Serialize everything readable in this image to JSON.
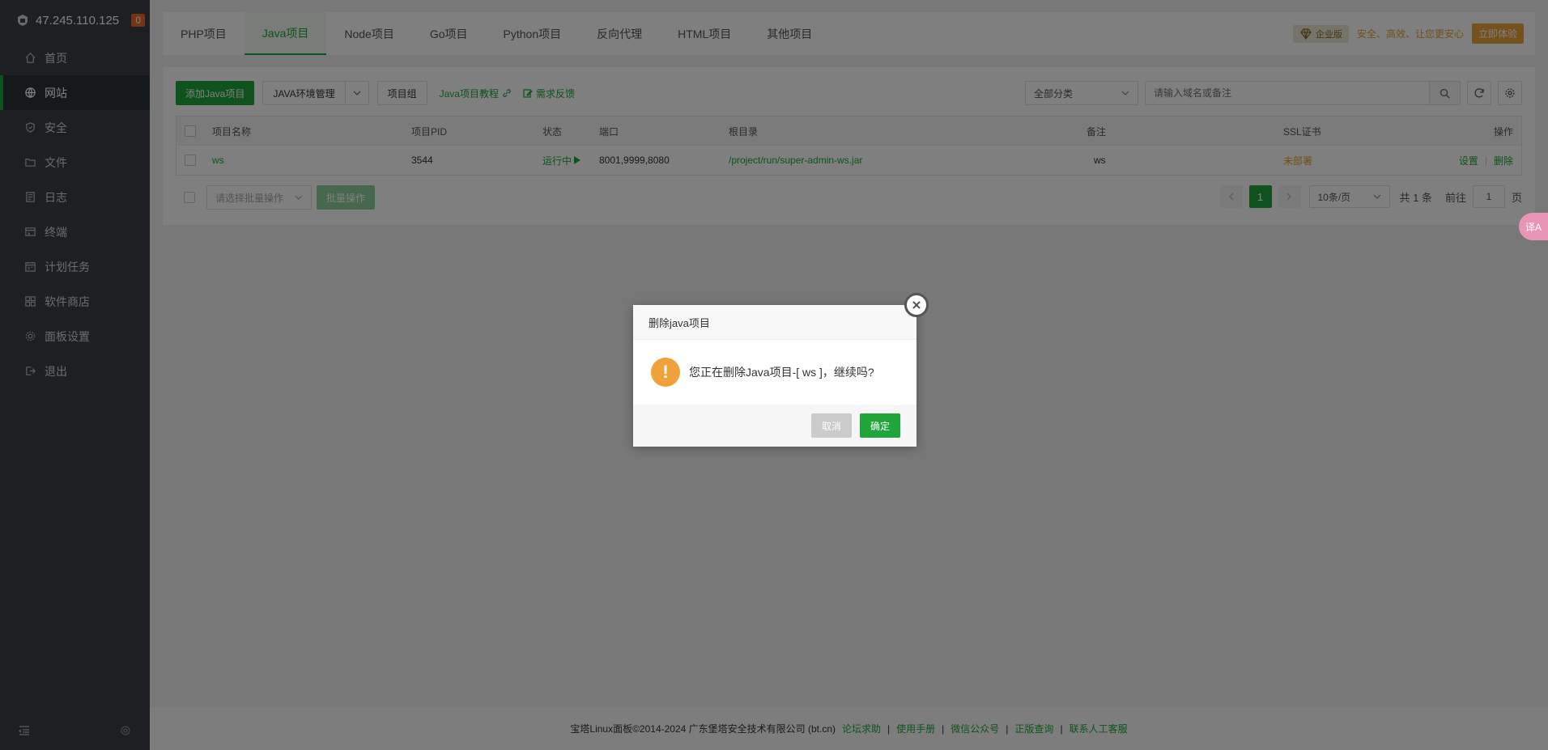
{
  "sidebar": {
    "server_ip": "47.245.110.125",
    "badge_count": "0",
    "items": [
      {
        "label": "首页",
        "icon": "home-icon"
      },
      {
        "label": "网站",
        "icon": "globe-icon",
        "active": true
      },
      {
        "label": "安全",
        "icon": "shield-icon"
      },
      {
        "label": "文件",
        "icon": "folder-icon"
      },
      {
        "label": "日志",
        "icon": "log-icon"
      },
      {
        "label": "终端",
        "icon": "terminal-icon"
      },
      {
        "label": "计划任务",
        "icon": "calendar-icon"
      },
      {
        "label": "软件商店",
        "icon": "apps-icon"
      },
      {
        "label": "面板设置",
        "icon": "gear-icon"
      },
      {
        "label": "退出",
        "icon": "logout-icon"
      }
    ]
  },
  "tabs": [
    "PHP项目",
    "Java项目",
    "Node项目",
    "Go项目",
    "Python项目",
    "反向代理",
    "HTML项目",
    "其他项目"
  ],
  "active_tab": "Java项目",
  "promo": {
    "edition": "企业版",
    "slogan": "安全、高效、让您更安心",
    "cta": "立即体验"
  },
  "toolbar": {
    "add_button": "添加Java项目",
    "env_manage": "JAVA环境管理",
    "project_group": "项目组",
    "tutorial": "Java项目教程",
    "feedback": "需求反馈",
    "category_select": "全部分类",
    "search_placeholder": "请输入域名或备注"
  },
  "table": {
    "headers": {
      "name": "项目名称",
      "pid": "项目PID",
      "status": "状态",
      "port": "端口",
      "root": "根目录",
      "remark": "备注",
      "ssl": "SSL证书",
      "actions": "操作"
    },
    "rows": [
      {
        "name": "ws",
        "pid": "3544",
        "status": "运行中",
        "port": "8001,9999,8080",
        "root": "/project/run/super-admin-ws.jar",
        "remark": "ws",
        "ssl": "未部署",
        "action_settings": "设置",
        "action_delete": "删除"
      }
    ]
  },
  "batch": {
    "select_placeholder": "请选择批量操作",
    "button": "批量操作"
  },
  "pagination": {
    "current_page": "1",
    "page_size": "10条/页",
    "total": "共 1 条",
    "goto_label": "前往",
    "goto_value": "1",
    "page_suffix": "页"
  },
  "footer": {
    "copyright": "宝塔Linux面板©2014-2024 广东堡塔安全技术有限公司 (bt.cn)",
    "links": [
      "论坛求助",
      "使用手册",
      "微信公众号",
      "正版查询",
      "联系人工客服"
    ]
  },
  "dialog": {
    "title": "删除java项目",
    "message": "您正在删除Java项目-[ ws ]，继续吗?",
    "cancel": "取消",
    "confirm": "确定"
  },
  "translate_widget": "译A",
  "colors": {
    "accent": "#20a53a",
    "sidebar_bg": "#3a3f46",
    "warning": "#f0a23a",
    "ssl_orange": "#e0a52a"
  }
}
